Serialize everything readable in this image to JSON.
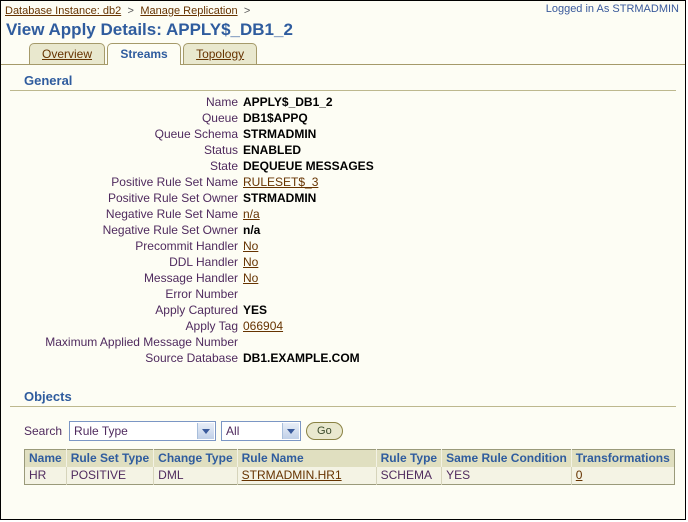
{
  "breadcrumb": {
    "items": [
      {
        "label": "Database Instance: db2",
        "separator": ">"
      },
      {
        "label": "Manage Replication",
        "separator": ">"
      }
    ]
  },
  "header": {
    "login_info": "Logged in As STRMADMIN",
    "title": "View Apply Details: APPLY$_DB1_2"
  },
  "tabs": [
    {
      "label": "Overview",
      "active": false
    },
    {
      "label": "Streams",
      "active": true
    },
    {
      "label": "Topology",
      "active": false
    }
  ],
  "general": {
    "heading": "General",
    "rows": [
      {
        "label": "Name",
        "value": "APPLY$_DB1_2",
        "link": false
      },
      {
        "label": "Queue",
        "value": "DB1$APPQ",
        "link": false
      },
      {
        "label": "Queue Schema",
        "value": "STRMADMIN",
        "link": false
      },
      {
        "label": "Status",
        "value": "ENABLED",
        "link": false
      },
      {
        "label": "State",
        "value": "DEQUEUE MESSAGES",
        "link": false
      },
      {
        "label": "Positive Rule Set Name",
        "value": "RULESET$_3",
        "link": true
      },
      {
        "label": "Positive Rule Set Owner",
        "value": "STRMADMIN",
        "link": false
      },
      {
        "label": "Negative Rule Set Name",
        "value": "n/a",
        "link": true
      },
      {
        "label": "Negative Rule Set Owner",
        "value": "n/a",
        "link": false
      },
      {
        "label": "Precommit Handler",
        "value": "No",
        "link": true
      },
      {
        "label": "DDL Handler",
        "value": "No",
        "link": true
      },
      {
        "label": "Message Handler",
        "value": "No",
        "link": true
      },
      {
        "label": "Error Number",
        "value": "",
        "link": false
      },
      {
        "label": "Apply Captured",
        "value": "YES",
        "link": false
      },
      {
        "label": "Apply Tag",
        "value": "066904",
        "link": true
      },
      {
        "label": "Maximum Applied Message Number",
        "value": "",
        "link": false
      },
      {
        "label": "Source Database",
        "value": "DB1.EXAMPLE.COM",
        "link": false
      }
    ]
  },
  "objects": {
    "heading": "Objects",
    "search": {
      "label": "Search",
      "criteria_value": "Rule Type",
      "filter_value": "All",
      "go_label": "Go"
    },
    "table": {
      "columns": [
        "Name",
        "Rule Set Type",
        "Change Type",
        "Rule Name",
        "Rule Type",
        "Same Rule Condition",
        "Transformations"
      ],
      "rows": [
        {
          "name": "HR",
          "rule_set_type": "POSITIVE",
          "change_type": "DML",
          "rule_name": "STRMADMIN.HR1",
          "rule_type": "SCHEMA",
          "same_rule_condition": "YES",
          "transformations": "0"
        }
      ]
    }
  },
  "colors": {
    "page_bg": "#fdfdf4",
    "heading_blue": "#2f5c9e",
    "link_brown": "#663300",
    "label_purple": "#4f2a5e",
    "tab_bg": "#e9e8ce",
    "table_header_bg": "#e0dfc0",
    "table_row_bg": "#f4f3e4"
  }
}
